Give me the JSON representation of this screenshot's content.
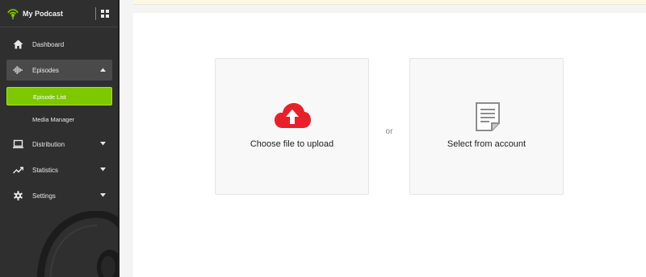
{
  "brand": {
    "name": "My Podcast"
  },
  "sidebar": {
    "items": [
      {
        "label": "Dashboard",
        "icon": "home-icon"
      },
      {
        "label": "Episodes",
        "icon": "waveform-icon",
        "expanded": true
      },
      {
        "label": "Episode List",
        "active": true
      },
      {
        "label": "Media Manager"
      },
      {
        "label": "Distribution",
        "icon": "laptop-icon"
      },
      {
        "label": "Statistics",
        "icon": "trending-icon"
      },
      {
        "label": "Settings",
        "icon": "gear-icon"
      }
    ]
  },
  "upload": {
    "choose_label": "Choose file to upload",
    "or_label": "or",
    "select_label": "Select from account"
  },
  "colors": {
    "sidebar_bg": "#2f2f2f",
    "active_green": "#7ec800",
    "upload_red": "#e8202a"
  }
}
